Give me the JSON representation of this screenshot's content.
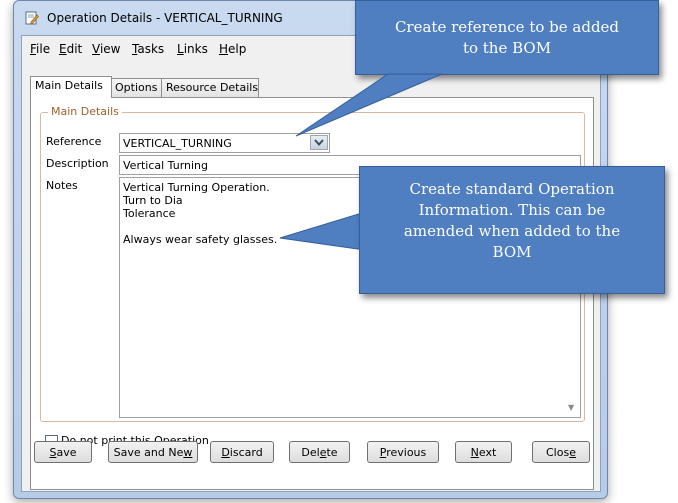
{
  "window": {
    "title": "Operation Details - VERTICAL_TURNING"
  },
  "menu": [
    {
      "key": "F",
      "rest": "ile"
    },
    {
      "key": "E",
      "rest": "dit"
    },
    {
      "key": "V",
      "rest": "iew"
    },
    {
      "key": "T",
      "rest": "asks"
    },
    {
      "key": "L",
      "rest": "inks"
    },
    {
      "key": "H",
      "rest": "elp"
    }
  ],
  "tabs": [
    "Main Details",
    "Options",
    "Resource Details"
  ],
  "group": {
    "label": "Main Details"
  },
  "fields": {
    "reference": {
      "label": "Reference",
      "value": "VERTICAL_TURNING"
    },
    "description": {
      "label": "Description",
      "value": "Vertical Turning"
    },
    "notes": {
      "label": "Notes",
      "lines": [
        "Vertical Turning Operation.",
        "Turn to Dia",
        "Tolerance",
        "",
        "Always wear safety glasses."
      ]
    }
  },
  "checkbox": {
    "label": "Do not print this Operation",
    "checked": false
  },
  "buttons": {
    "save": {
      "key": "S",
      "rest": "ave"
    },
    "save_and_new": {
      "pre": "Save and Ne",
      "key": "w",
      "rest": ""
    },
    "discard": {
      "key": "D",
      "rest": "iscard"
    },
    "delete": {
      "pre": "Del",
      "key": "e",
      "rest": "te"
    },
    "previous": {
      "key": "P",
      "rest": "revious"
    },
    "next": {
      "key": "N",
      "rest": "ext"
    },
    "close": {
      "pre": "Clos",
      "key": "e",
      "rest": ""
    }
  },
  "callouts": {
    "top": [
      "Create reference to be added",
      "to the BOM"
    ],
    "middle": [
      "Create standard Operation",
      "Information.  This can be",
      "amended when added to the",
      "BOM"
    ]
  },
  "colors": {
    "callout_fill": "#4f7ec1",
    "group_label": "#a0622d"
  }
}
